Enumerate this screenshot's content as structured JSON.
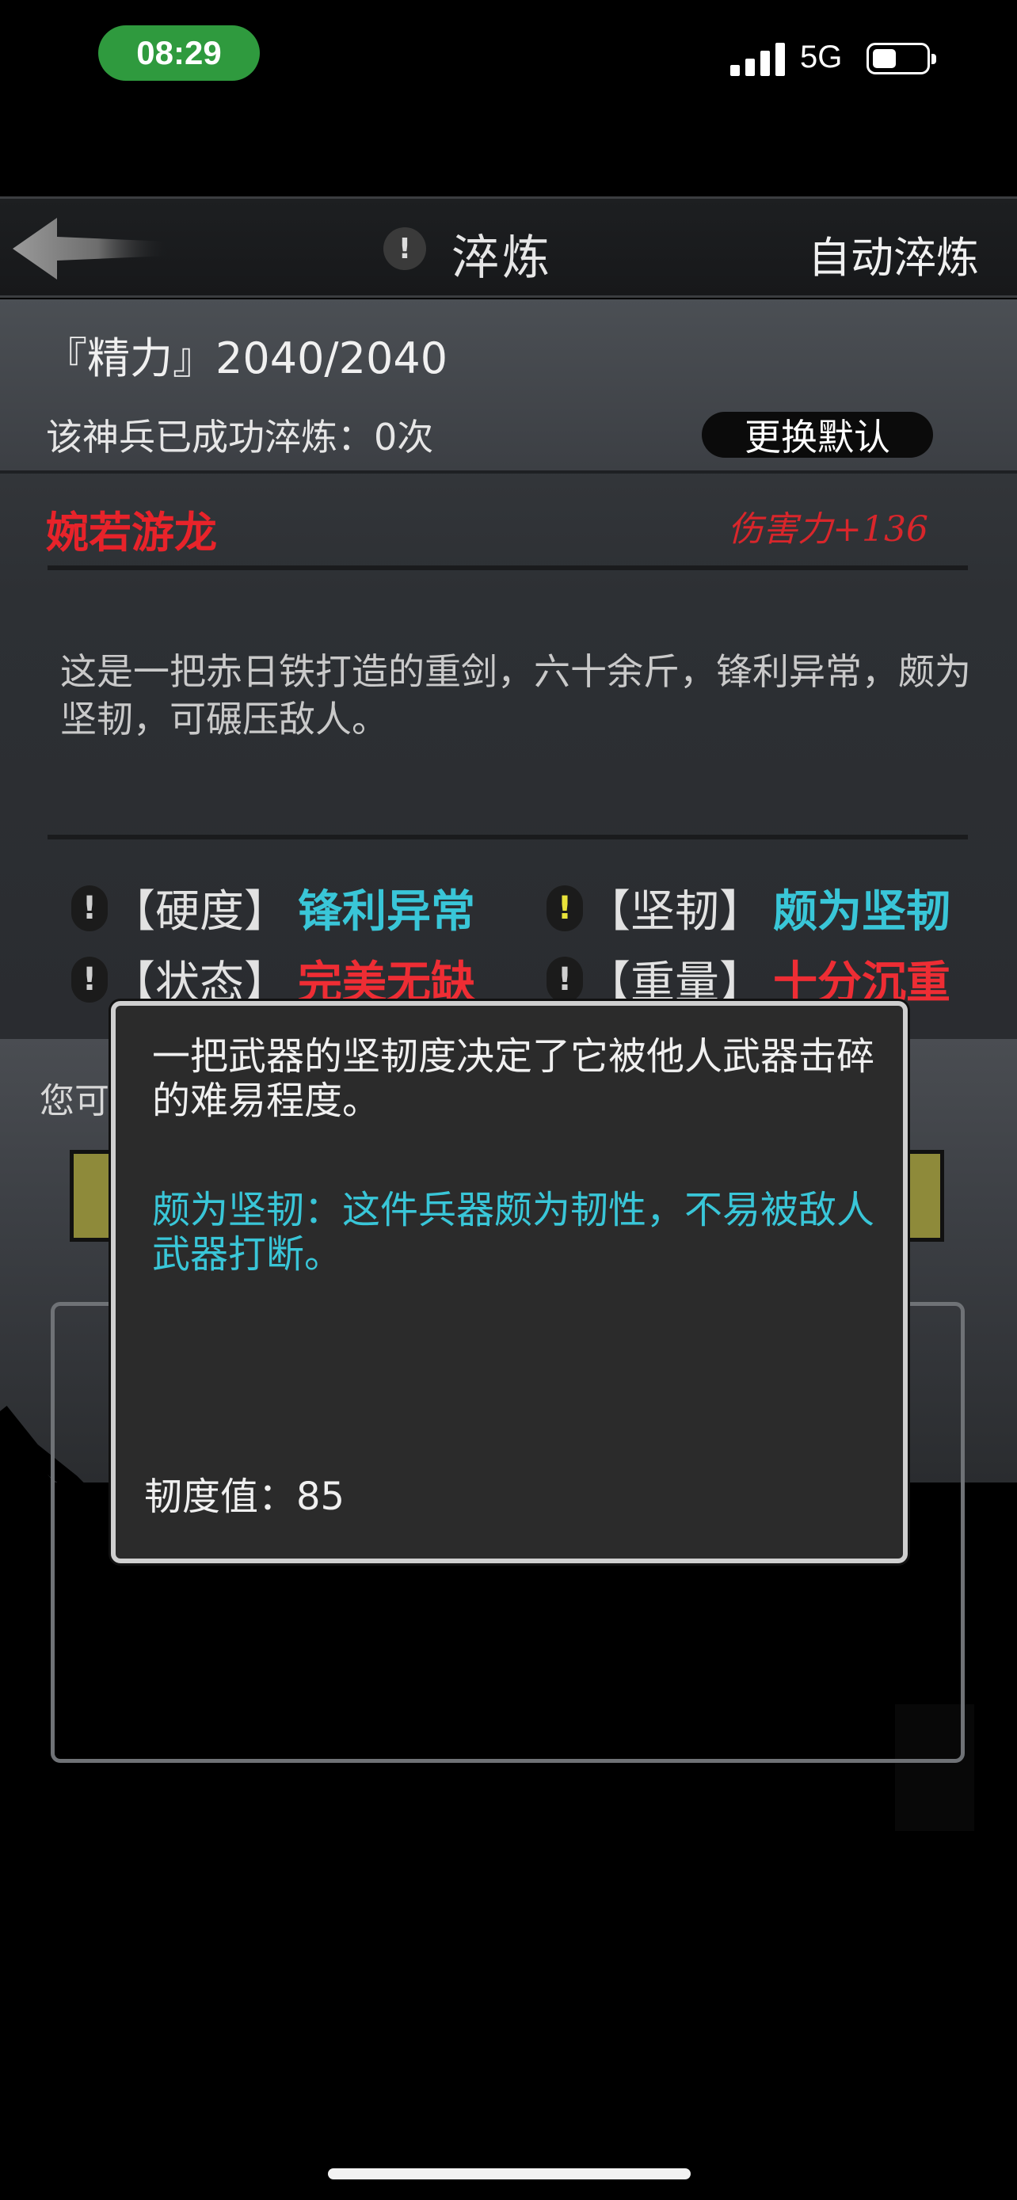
{
  "status_bar": {
    "time": "08:29",
    "network": "5G",
    "battery_level": 0.45
  },
  "header": {
    "back_icon": "back-arrow-icon",
    "info_icon": "!",
    "title": "淬炼",
    "auto_label": "自动淬炼"
  },
  "stats": {
    "energy": "『精力』2040/2040",
    "refined_count": "该神兵已成功淬炼：0次",
    "change_default_label": "更换默认"
  },
  "weapon": {
    "name": "婉若游龙",
    "damage": "伤害力+136",
    "description": "这是一把赤日铁打造的重剑，六十余斤，锋利异常，颇为坚韧，可碾压敌人。"
  },
  "attributes": [
    {
      "icon": "!",
      "key": "【硬度】",
      "value": "锋利异常",
      "color": "#39c6d8"
    },
    {
      "icon": "!",
      "key": "【坚韧】",
      "value": "颇为坚韧",
      "color": "#39c6d8"
    },
    {
      "icon": "!",
      "key": "【状态】",
      "value": "完美无缺",
      "color": "#ee2d34"
    },
    {
      "icon": "!",
      "key": "【重量】",
      "value": "十分沉重",
      "color": "#ee2d34"
    }
  ],
  "background": {
    "partial_text": "您可"
  },
  "tooltip": {
    "main": "一把武器的坚韧度决定了它被他人武器击碎的难易程度。",
    "detail": "颇为坚韧：这件兵器颇为韧性，不易被敌人武器打断。",
    "value": "韧度值：85"
  }
}
